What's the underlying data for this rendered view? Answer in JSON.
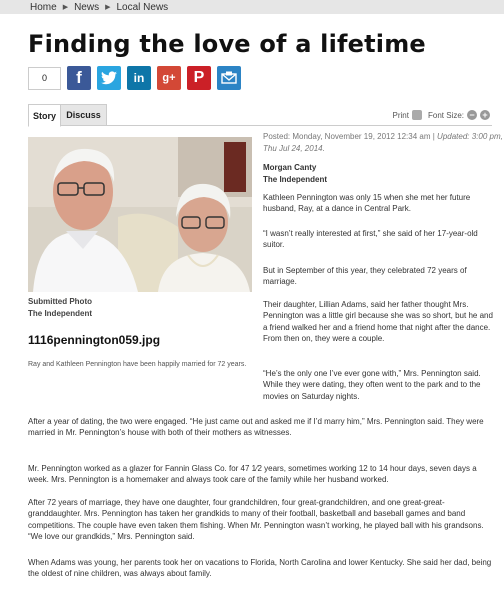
{
  "breadcrumb": [
    "Home",
    "News",
    "Local News"
  ],
  "article": {
    "title": "Finding the love of a lifetime",
    "share_count": "0",
    "share_buttons": [
      {
        "name": "facebook",
        "glyph": "f",
        "icon": "facebook-icon"
      },
      {
        "name": "twitter",
        "glyph": "",
        "icon": "twitter-icon"
      },
      {
        "name": "linkedin",
        "glyph": "in",
        "icon": "linkedin-icon"
      },
      {
        "name": "googleplus",
        "glyph": "g+",
        "icon": "google-plus-icon"
      },
      {
        "name": "pinterest",
        "glyph": "P",
        "icon": "pinterest-icon"
      },
      {
        "name": "email",
        "glyph": "",
        "icon": "email-icon"
      }
    ],
    "tabs": {
      "story": "Story",
      "discuss": "Discuss"
    },
    "tools": {
      "print": "Print",
      "font_size": "Font Size:",
      "minus": "−",
      "plus": "+"
    },
    "meta": {
      "posted": "Posted: Monday, November 19, 2012 12:34 am |",
      "updated": "Updated: 3:00 pm, Thu Jul 24, 2014."
    },
    "byline": {
      "author": "Morgan Canty",
      "org": "The Independent"
    },
    "photo": {
      "credit_line1": "Submitted Photo",
      "credit_line2": "The Independent",
      "filename": "1116pennington059.jpg",
      "caption": "Ray and Kathleen Pennington have been happily married for 72 years."
    },
    "paragraphs_narrow": [
      "Kathleen Pennington was only 15 when she met her future husband, Ray, at a dance in Central Park.",
      "“I wasn’t really interested at first,” she said of her 17-year-old suitor.",
      "But in September of this year, they celebrated 72 years of marriage.",
      "Their daughter, Lillian Adams, said her father thought Mrs. Pennington was a little girl because she was so short, but he and a friend walked her and a friend home that night after the dance.  From then on, they were a couple.",
      "“He’s the only one I’ve ever gone with,” Mrs. Pennington said. While they were dating, they often went to the park and to the movies on Saturday nights."
    ],
    "paragraphs_wide": [
      "After a year of dating, the two were engaged. “He just came out and asked me if I’d marry him,” Mrs. Pennington said. They were married in Mr. Pennington’s house with both of their mothers as witnesses.",
      "Mr. Pennington worked as a glazer for Fannin Glass Co. for 47 1⁄2 years, sometimes working 12 to 14 hour days, seven days a week. Mrs. Pennington is a homemaker and always took care of the family while her husband worked.",
      "After 72 years of marriage, they have one daughter, four grandchildren, four great-grandchildren, and one great-great-granddaughter. Mrs. Pennington has taken her grandkids to many of their football, basketball and baseball games and band competitions. The couple have even taken them fishing. When Mr. Pennington wasn’t working, he played ball with his grandsons. “We love our grandkids,” Mrs. Pennington said.",
      "When Adams was young, her parents took her on vacations to Florida, North Carolina and lower Kentucky. She said her dad, being the oldest of nine children, was always about family."
    ]
  }
}
